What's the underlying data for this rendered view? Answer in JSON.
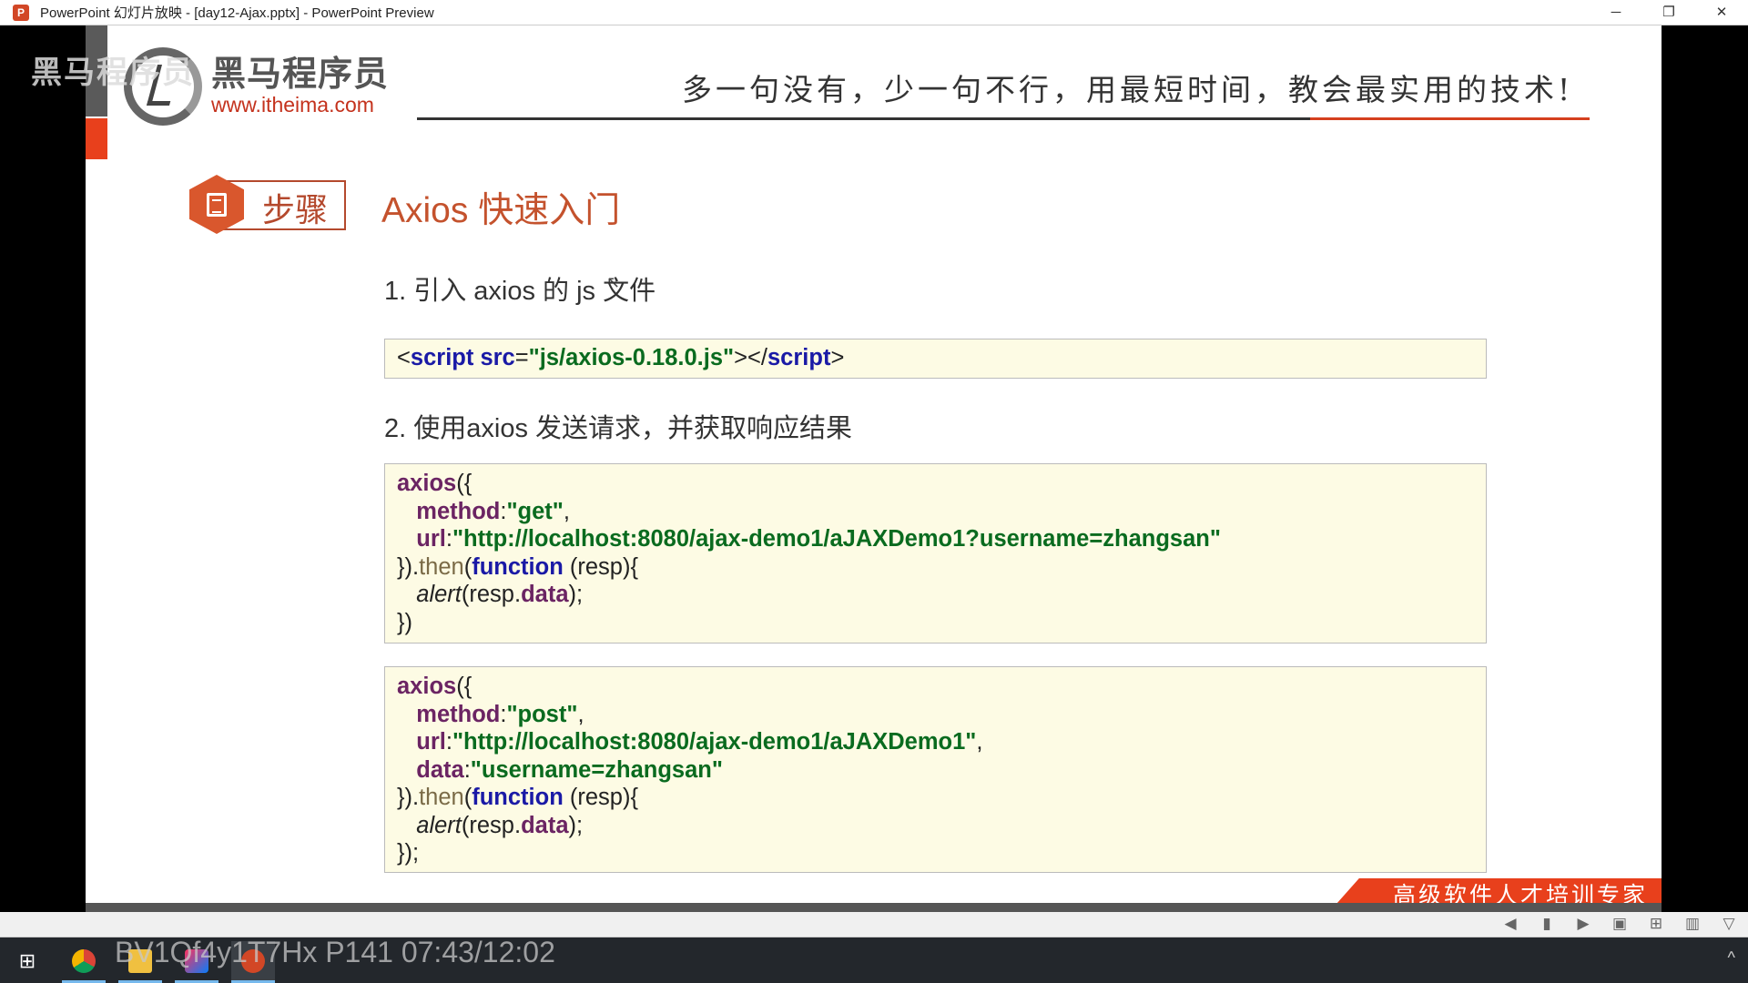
{
  "window": {
    "title": "PowerPoint 幻灯片放映 - [day12-Ajax.pptx] - PowerPoint Preview",
    "app_icon": "P"
  },
  "slide": {
    "watermark": "黑马程序员",
    "logo": {
      "cn": "黑马程序员",
      "url": "www.itheima.com"
    },
    "slogan": "多一句没有，少一句不行，用最短时间，教会最实用的技术!",
    "badge_label": "步骤",
    "title": "Axios 快速入门",
    "step1": "1. 引入 axios 的 js 文件",
    "step2": "2. 使用axios 发送请求，并获取响应结果",
    "code1": {
      "open": "<",
      "tag": "script",
      "attr": " src",
      "eq": "=",
      "val": "\"js/axios-0.18.0.js\"",
      "mid": "></",
      "tag2": "script",
      "close": ">"
    },
    "code2": {
      "url": "\"http://localhost:8080/ajax-demo1/aJAXDemo1?username=zhangsan\"",
      "method": "\"get\""
    },
    "code3": {
      "url": "\"http://localhost:8080/ajax-demo1/aJAXDemo1\"",
      "method": "\"post\"",
      "data": "\"username=zhangsan\""
    },
    "banner": "高级软件人才培训专家"
  },
  "overlay_text": "BV1Qf4y1T7Hx P141 07:43/12:02",
  "controls": [
    "◀",
    "▮",
    "▶",
    "▣",
    "⊞",
    "▥",
    "▽"
  ]
}
